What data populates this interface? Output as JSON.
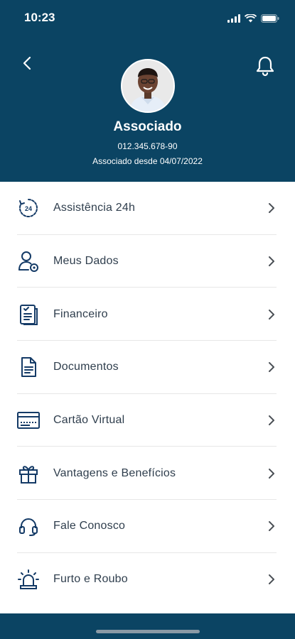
{
  "status_bar": {
    "time": "10:23"
  },
  "header": {
    "name": "Associado",
    "document": "012.345.678-90",
    "member_since": "Associado desde 04/07/2022",
    "background_color": "#0b4463"
  },
  "menu": {
    "items": [
      {
        "label": "Assistência 24h",
        "icon": "clock-24h-icon"
      },
      {
        "label": "Meus Dados",
        "icon": "user-settings-icon"
      },
      {
        "label": "Financeiro",
        "icon": "checklist-icon"
      },
      {
        "label": "Documentos",
        "icon": "document-icon"
      },
      {
        "label": "Cartão Virtual",
        "icon": "card-icon"
      },
      {
        "label": "Vantagens e Benefícios",
        "icon": "gift-icon"
      },
      {
        "label": "Fale Conosco",
        "icon": "headset-icon"
      },
      {
        "label": "Furto e Roubo",
        "icon": "siren-icon"
      }
    ]
  },
  "colors": {
    "icon": "#143a66",
    "text": "#2f3e4d",
    "divider": "#e7e7e7"
  }
}
